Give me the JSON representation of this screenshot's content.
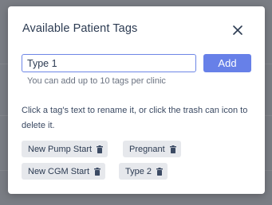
{
  "modal": {
    "title": "Available Patient Tags",
    "close_icon": "close-icon"
  },
  "form": {
    "input_value": "Type 1",
    "add_label": "Add",
    "hint": "You can add up to 10 tags per clinic"
  },
  "instructions": "Click a tag's text to rename it, or click the trash can icon to delete it.",
  "tags": [
    {
      "label": "New Pump Start",
      "icon": "trash-icon"
    },
    {
      "label": "Pregnant",
      "icon": "trash-icon"
    },
    {
      "label": "New CGM Start",
      "icon": "trash-icon"
    },
    {
      "label": "Type 2",
      "icon": "trash-icon"
    }
  ],
  "colors": {
    "accent": "#6780e8",
    "input_border": "#6d86e6",
    "title_text": "#2c3b52",
    "tag_bg": "#e6e8ec",
    "overlay": "#7a7d84"
  }
}
